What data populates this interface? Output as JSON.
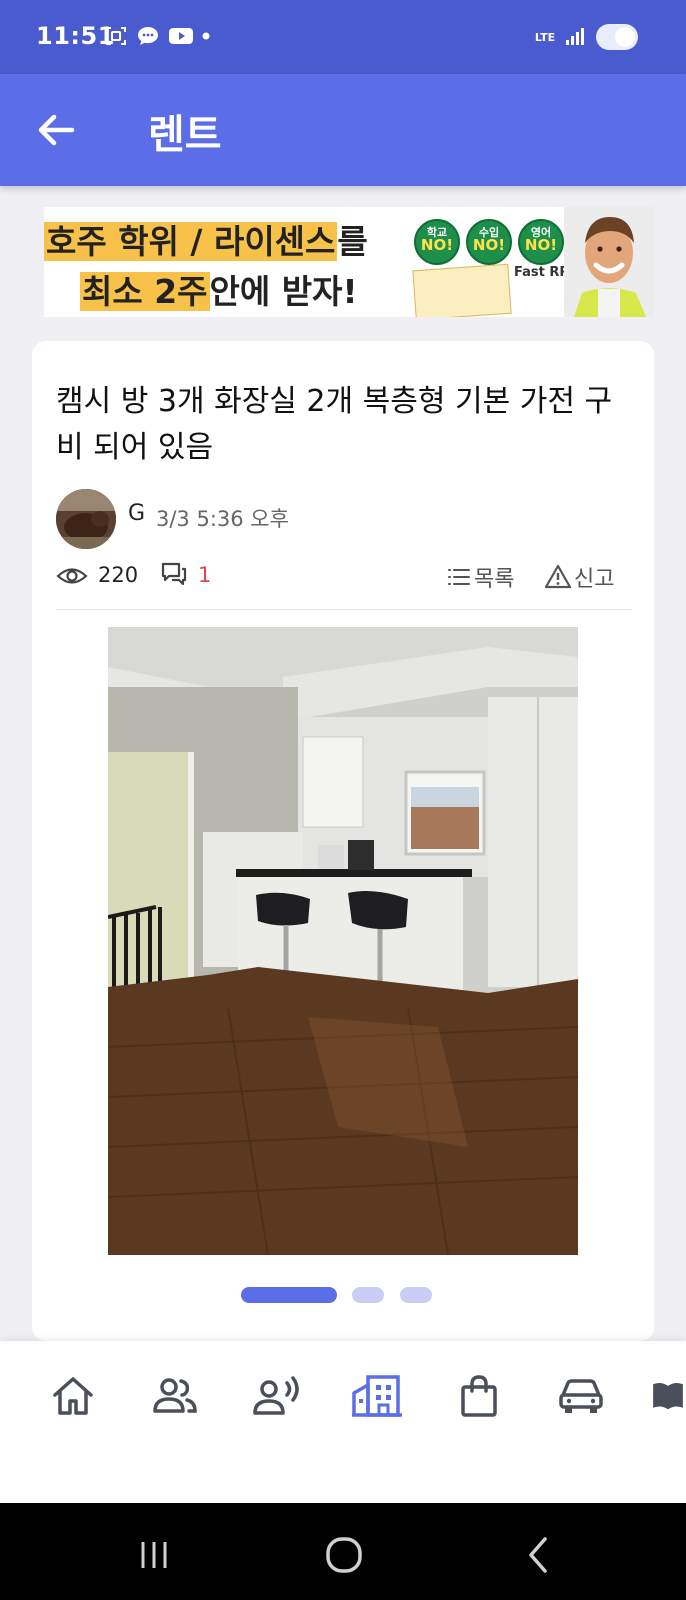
{
  "status_bar": {
    "time": "11:51",
    "network": "LTE",
    "icons_left": [
      "screenshot-icon",
      "chat-icon",
      "youtube-icon",
      "dot-icon"
    ],
    "icons_right": [
      "lte-icon",
      "signal-icon",
      "toggle-icon"
    ]
  },
  "app_bar": {
    "back_icon": "arrow-left-icon",
    "title": "렌트"
  },
  "ad": {
    "line1_hl": "호주 학위 / 라이센스",
    "line1_tail": "를",
    "line2_hl": "최소 2주",
    "line2_tail": "안에 받자!",
    "badges": [
      {
        "top": "학교",
        "bottom": "NO!"
      },
      {
        "top": "수입",
        "bottom": "NO!"
      },
      {
        "top": "영어",
        "bottom": "NO!"
      }
    ],
    "brand": "Fast RPL"
  },
  "post": {
    "title": "캠시 방 3개 화장실 2개 복층형 기본 가전 구비 되어 있음",
    "author": "G",
    "date": "3/3 5:36 오후",
    "views": "220",
    "comments": "1",
    "list_label": "목록",
    "report_label": "신고",
    "image_count": 3,
    "active_image": 1
  },
  "bottom_nav": {
    "items": [
      {
        "icon": "home-icon",
        "active": false
      },
      {
        "icon": "people-icon",
        "active": false
      },
      {
        "icon": "broadcast-person-icon",
        "active": false
      },
      {
        "icon": "buildings-icon",
        "active": true
      },
      {
        "icon": "shopping-bag-icon",
        "active": false
      },
      {
        "icon": "car-icon",
        "active": false
      },
      {
        "icon": "book-icon",
        "active": false
      }
    ]
  },
  "colors": {
    "status_bar": "#4a5bd0",
    "app_bar": "#5b6ee8",
    "accent": "#5b6ee8",
    "dot_inactive": "#c9cdf5",
    "comment_count": "#e0454d",
    "nav_inactive": "#4a4f5a"
  }
}
